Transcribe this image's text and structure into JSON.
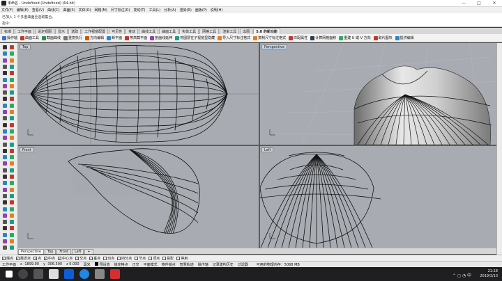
{
  "window": {
    "title": "未命名 - Undefined (Undefined) (64-bit)",
    "minimize": "—",
    "maximize": "□",
    "close": "✕"
  },
  "menu": [
    "文件(F)",
    "编辑(E)",
    "查看(V)",
    "曲线(C)",
    "曲面(S)",
    "实体(O)",
    "网格(M)",
    "尺寸标注(D)",
    "变动(T)",
    "工具(L)",
    "分析(A)",
    "渲染(R)",
    "面板(P)",
    "说明(H)"
  ],
  "command": {
    "history": "已加入 1 个多重曲面至选取集合。",
    "prompt": "指令:",
    "value": ""
  },
  "tabs": [
    {
      "label": "标准",
      "active": false
    },
    {
      "label": "工作平面",
      "active": false
    },
    {
      "label": "设定视图",
      "active": false
    },
    {
      "label": "显示",
      "active": false
    },
    {
      "label": "选取",
      "active": false
    },
    {
      "label": "工作视窗配置",
      "active": false
    },
    {
      "label": "可见性",
      "active": false
    },
    {
      "label": "变动",
      "active": false
    },
    {
      "label": "曲线工具",
      "active": false
    },
    {
      "label": "曲面工具",
      "active": false
    },
    {
      "label": "实体工具",
      "active": false
    },
    {
      "label": "网格工具",
      "active": false
    },
    {
      "label": "渲染工具",
      "active": false
    },
    {
      "label": "出图",
      "active": false
    },
    {
      "label": "5.0 的新功能",
      "active": true
    }
  ],
  "toolbar": [
    {
      "label": "操作轴",
      "color": "#3a70c8"
    },
    {
      "label": "曲面工具",
      "color": "#c0392b"
    },
    {
      "label": "截面曲线",
      "color": "#2e8b57"
    },
    {
      "label": "重复执行",
      "color": "#777777"
    },
    {
      "label": "方向编辑",
      "color": "#d35400"
    },
    {
      "label": "断平面",
      "color": "#2e86c1"
    },
    {
      "label": "等高截平面",
      "color": "#c0392b"
    },
    {
      "label": "剖面线延伸",
      "color": "#8e44ad"
    },
    {
      "label": "将图层在子视窗里隐藏",
      "color": "#16a085"
    },
    {
      "label": "导入尺寸标注格式",
      "color": "#e67e22"
    },
    {
      "label": "复制尺寸标注格式",
      "color": "#e67e22"
    },
    {
      "label": "匹配属性",
      "color": "#c0392b"
    },
    {
      "label": "计算网格面积",
      "color": "#2c3e50"
    },
    {
      "label": "重建 U 或 V 方向",
      "color": "#27ae60"
    },
    {
      "label": "取代图块",
      "color": "#c0392b"
    },
    {
      "label": "提供编辑",
      "color": "#2e86c1"
    }
  ],
  "viewports": {
    "top": "Top",
    "perspective": "Perspective",
    "front": "Front",
    "left": "Left"
  },
  "viewport_tabs": [
    {
      "label": "Perspective",
      "active": true
    },
    {
      "label": "Top",
      "active": false
    },
    {
      "label": "Front",
      "active": false
    },
    {
      "label": "Left",
      "active": false
    },
    {
      "label": "+",
      "active": false
    }
  ],
  "osnaps": [
    {
      "label": "端点",
      "checked": true
    },
    {
      "label": "最近点",
      "checked": true
    },
    {
      "label": "点",
      "checked": true
    },
    {
      "label": "中点",
      "checked": true
    },
    {
      "label": "中心点",
      "checked": true
    },
    {
      "label": "交点",
      "checked": true
    },
    {
      "label": "垂点",
      "checked": true
    },
    {
      "label": "切点",
      "checked": false
    },
    {
      "label": "四分点",
      "checked": false
    },
    {
      "label": "节点",
      "checked": false
    },
    {
      "label": "顶点",
      "checked": false
    },
    {
      "label": "投影",
      "checked": false
    },
    {
      "label": "停用",
      "checked": false
    }
  ],
  "status": {
    "cplane": "工作平面",
    "x": "x -1899.90",
    "y": "y -306.590",
    "z": "z 0.000",
    "unit": "毫米",
    "layer": "预设值",
    "items": [
      "锁定格点",
      "正交",
      "平面模式",
      "物件锁点",
      "智慧轨迹",
      "操作轴",
      "记录建构历史",
      "过滤器"
    ],
    "memory": "可用的物理内存：5068 MB"
  },
  "taskbar": {
    "time": "21:18",
    "date": "2019/3/10"
  }
}
